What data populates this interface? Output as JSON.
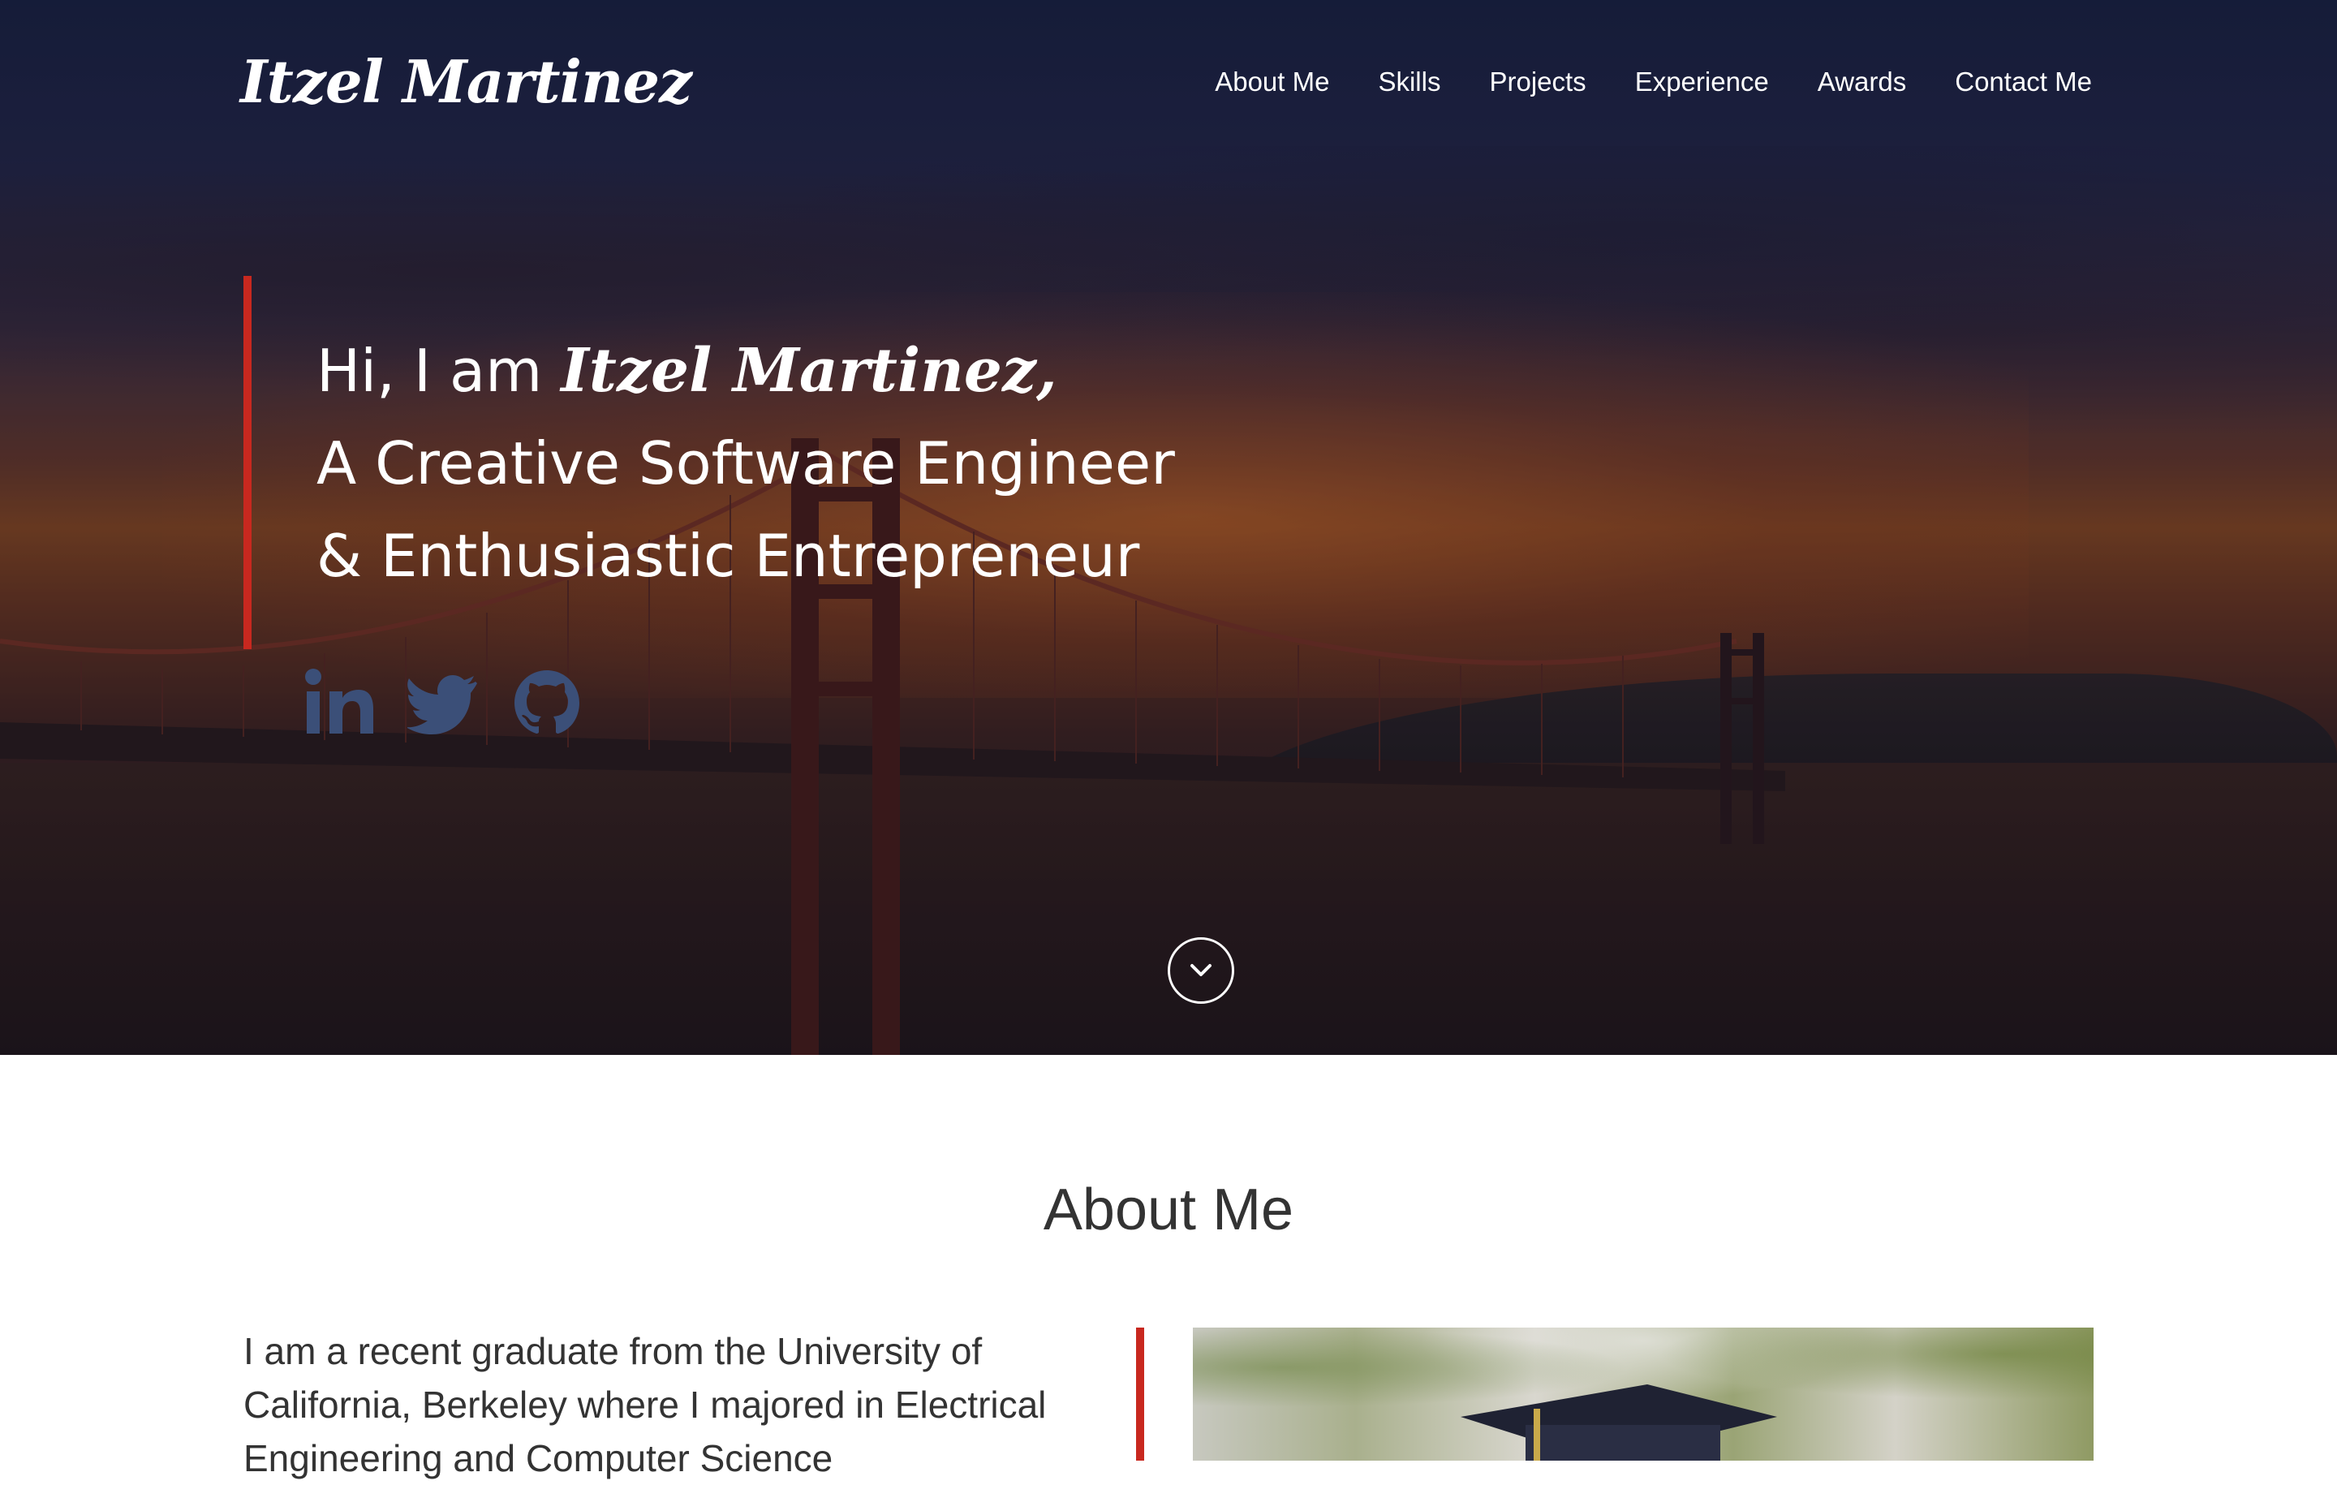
{
  "nav": {
    "logo": "Itzel Martinez",
    "links": [
      "About Me",
      "Skills",
      "Projects",
      "Experience",
      "Awards",
      "Contact Me"
    ]
  },
  "hero": {
    "greeting": "Hi, I am",
    "name": "Itzel Martinez,",
    "line2": "A Creative Software Engineer",
    "line3": "& Enthusiastic Entrepreneur",
    "social_icons": [
      "linkedin-icon",
      "twitter-icon",
      "github-icon"
    ],
    "social_icon_color": "#3b4f78",
    "accent_color": "#c8281f",
    "scroll_icon": "chevron-down-icon"
  },
  "about": {
    "heading": "About Me",
    "text": "I am a recent graduate from the University of California, Berkeley where I majored in Electrical Engineering and Computer Science"
  }
}
